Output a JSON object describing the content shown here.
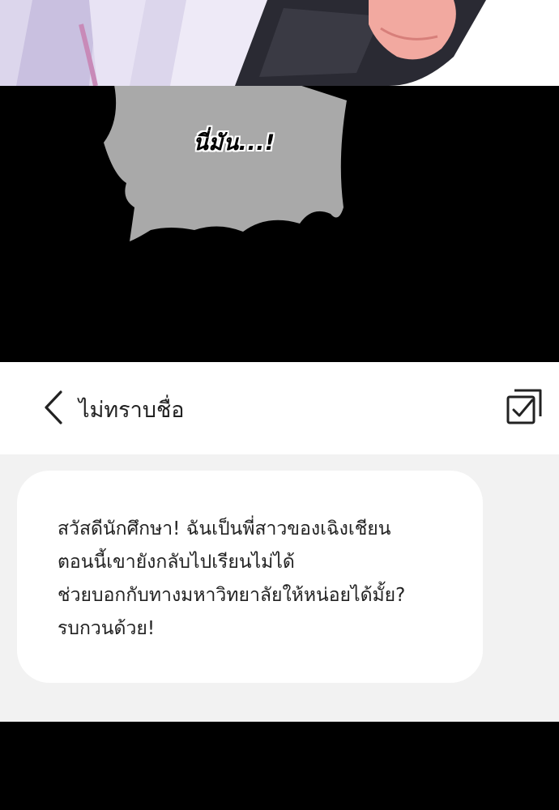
{
  "bubble": {
    "text": "นี่มัน...!"
  },
  "chat": {
    "contact_name": "ไม่ทราบชื่อ",
    "back_icon": "chevron-left-icon",
    "select_icon": "checkbox-select-icon",
    "message_lines": [
      "สวัสดีนักศึกษา! ฉันเป็นพี่สาวของเฉิงเชียน",
      "ตอนนี้เขายังกลับไปเรียนไม่ได้",
      "ช่วยบอกกับทางมหาวิทยาลัยให้หน่อยได้มั้ย?",
      "รบกวนด้วย!"
    ]
  },
  "colors": {
    "header_bg": "#ffffff",
    "chat_bg": "#f2f2f2",
    "bubble_bg": "#ffffff",
    "speech_bubble": "#a9a9a9"
  }
}
